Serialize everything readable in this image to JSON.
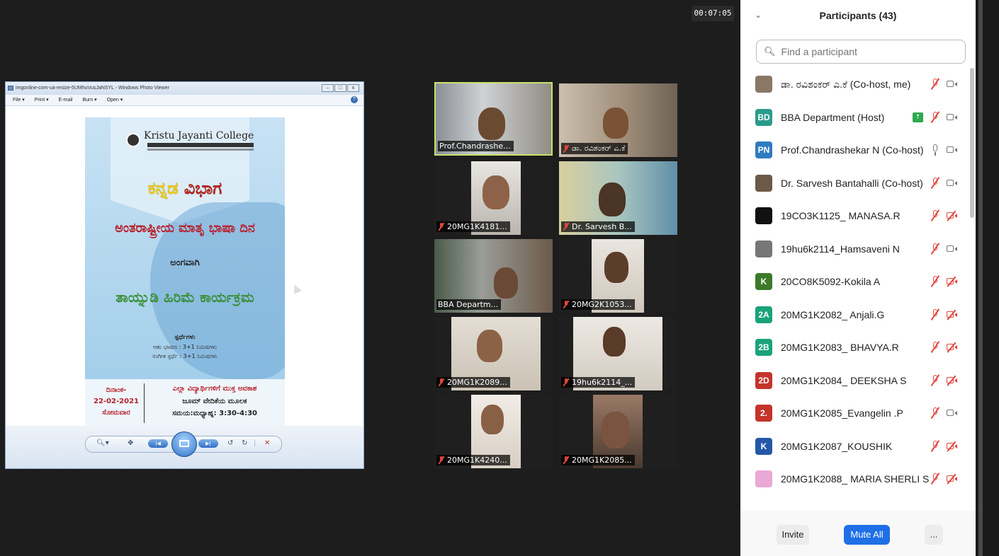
{
  "meeting": {
    "timer": "00:07:05"
  },
  "photo_viewer": {
    "title": "imgonline-com-ua-resize-5UMhuVusJaNSYL - Windows Photo Viewer",
    "menu": [
      "File ▾",
      "Print ▾",
      "E-mail",
      "Burn ▾",
      "Open ▾"
    ],
    "help": "?"
  },
  "poster": {
    "college_name": "Kristu Jayanti College",
    "dept_title_1": "ಕನ್ನಡ",
    "dept_title_2": "ವಿಭಾಗ",
    "intl_day": "ಅಂತರಾಷ್ಟ್ರೀಯ ಮಾತೃ ಭಾಷಾ ದಿನ",
    "angavagi": "ಅಂಗವಾಗಿ",
    "event": "ತಾಯ್ನುಡಿ ಹಿರಿಮೆ ಕಾರ್ಯಕ್ರಮ",
    "competitions": "ಸ್ಪರ್ಧೆಗಳು",
    "comp_1": "ಆಶು ಭಾಷಣ : 3+1 ನಿಮಿಷಗಳು",
    "comp_2": "ಸಂಗೀತ ಸ್ಪರ್ಧೆ : 3+1 ನಿಮಿಷಗಳು",
    "date_label": "ದಿನಾಂಕ-",
    "date": "22-02-2021",
    "weekday": "ಸೋಮವಾರ",
    "open_to_all": "ಎಲ್ಲಾ ವಿದ್ಯಾರ್ಥಿಗಳಿಗೆ ಮುಕ್ತ ಅವಕಾಶ",
    "platform": "ಜೂಮ್ ವೇದಿಕೆಯ ಮೂಲಕ",
    "time": "ಸಮಯ:ಮಧ್ಯಾಹ್ನ: 3:30-4:30"
  },
  "video_tiles": [
    {
      "name": "Prof.Chandrashe...",
      "muted": false
    },
    {
      "name": "ಡಾ. ರವಿಶಂಕರ್ ಎ.ಕೆ",
      "muted": true
    },
    {
      "name": "20MG1K4181...",
      "muted": true
    },
    {
      "name": "Dr. Sarvesh B...",
      "muted": true
    },
    {
      "name": "BBA Departm...",
      "muted": false
    },
    {
      "name": "20MG2K1053...",
      "muted": true
    },
    {
      "name": "20MG1K2089...",
      "muted": true
    },
    {
      "name": "19hu6k2114_...",
      "muted": true
    },
    {
      "name": "20MG1K4240...",
      "muted": true
    },
    {
      "name": "20MG1K2085...",
      "muted": true
    }
  ],
  "participants_panel": {
    "title": "Participants (43)",
    "search_placeholder": "Find a participant",
    "participants": [
      {
        "avatar": "",
        "avatar_color": "#8a7866",
        "name": "ಡಾ. ರವಿಶಂಕರ್ ಎ.ಕೆ (Co-host, me)",
        "mic": "off",
        "cam": "on"
      },
      {
        "avatar": "BD",
        "avatar_color": "#2b9b8a",
        "name": "BBA Department (Host)",
        "mic": "off",
        "cam": "on",
        "sharing": true
      },
      {
        "avatar": "PN",
        "avatar_color": "#2f7bbf",
        "name": "Prof.Chandrashekar N (Co-host)",
        "mic": "on",
        "cam": "on"
      },
      {
        "avatar": "",
        "avatar_color": "#6b5a48",
        "name": "Dr. Sarvesh Bantahalli (Co-host)",
        "mic": "off",
        "cam": "on"
      },
      {
        "avatar": "",
        "avatar_color": "#111111",
        "name": "19CO3K1125_ MANASA.R",
        "mic": "off",
        "cam": "off"
      },
      {
        "avatar": "",
        "avatar_color": "#777777",
        "name": "19hu6k2114_Hamsaveni N",
        "mic": "off",
        "cam": "on"
      },
      {
        "avatar": "K",
        "avatar_color": "#3d7a2a",
        "name": "20CO8K5092-Kokila A",
        "mic": "off",
        "cam": "off"
      },
      {
        "avatar": "2A",
        "avatar_color": "#1aa37a",
        "name": "20MG1K2082_ Anjali.G",
        "mic": "off",
        "cam": "off"
      },
      {
        "avatar": "2B",
        "avatar_color": "#1aa37a",
        "name": "20MG1K2083_ BHAVYA.R",
        "mic": "off",
        "cam": "off"
      },
      {
        "avatar": "2D",
        "avatar_color": "#c4342b",
        "name": "20MG1K2084_ DEEKSHA S",
        "mic": "off",
        "cam": "off"
      },
      {
        "avatar": "2.",
        "avatar_color": "#c4342b",
        "name": "20MG1K2085_Evangelin .P",
        "mic": "off",
        "cam": "on"
      },
      {
        "avatar": "K",
        "avatar_color": "#2658a8",
        "name": "20MG1K2087_KOUSHIK",
        "mic": "off",
        "cam": "off"
      },
      {
        "avatar": "",
        "avatar_color": "#e9a9d6",
        "name": "20MG1K2088_ MARIA SHERLI S",
        "mic": "off",
        "cam": "off"
      }
    ],
    "invite_label": "Invite",
    "mute_all_label": "Mute All",
    "more_label": "..."
  },
  "colors": {
    "active_speaker_border": "#c8e26c",
    "mute_red": "#e0463e",
    "zoom_blue": "#1f6fe6"
  }
}
